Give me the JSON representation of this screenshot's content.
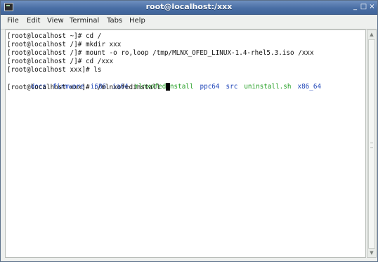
{
  "window": {
    "title": "root@localhost:/xxx",
    "minimize_glyph": "_",
    "maximize_glyph": "□",
    "close_glyph": "×"
  },
  "menu": [
    {
      "label": "File"
    },
    {
      "label": "Edit"
    },
    {
      "label": "View"
    },
    {
      "label": "Terminal"
    },
    {
      "label": "Tabs"
    },
    {
      "label": "Help"
    }
  ],
  "terminal": {
    "lines": [
      "[root@localhost ~]# cd /",
      "[root@localhost /]# mkdir xxx",
      "[root@localhost /]# mount -o ro,loop /tmp/MLNX_OFED_LINUX-1.4-rhel5.3.iso /xxx",
      "[root@localhost /]# cd /xxx",
      "[root@localhost xxx]# ls"
    ],
    "ls_output": [
      {
        "name": "docs",
        "kind": "dir"
      },
      {
        "name": "firmware",
        "kind": "dir"
      },
      {
        "name": "i686",
        "kind": "dir"
      },
      {
        "name": "ia64",
        "kind": "dir"
      },
      {
        "name": "mlnxofedinstall",
        "kind": "exe"
      },
      {
        "name": "ppc64",
        "kind": "dir"
      },
      {
        "name": "src",
        "kind": "dir"
      },
      {
        "name": "uninstall.sh",
        "kind": "exe"
      },
      {
        "name": "x86_64",
        "kind": "dir"
      }
    ],
    "current_prompt": "[root@localhost xxx]# ./mlnxofedinstall "
  },
  "colors": {
    "directory": "#1d44b8",
    "executable": "#26a026",
    "titlebar": "#4a6fa5"
  },
  "icons": {
    "app": "terminal-icon",
    "scroll_up": "chevron-up-icon",
    "scroll_down": "chevron-down-icon"
  }
}
